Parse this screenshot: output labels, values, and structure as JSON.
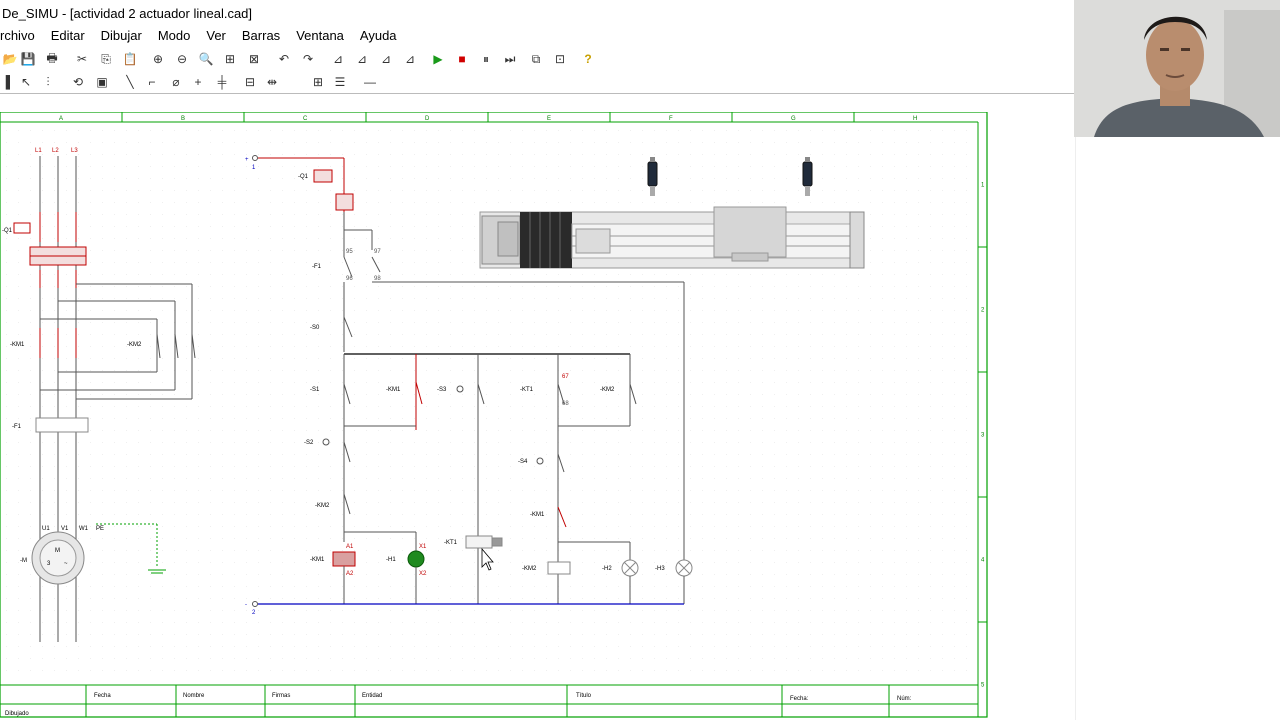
{
  "window": {
    "title": "De_SIMU - [actividad 2 actuador lineal.cad]"
  },
  "menu": [
    "rchivo",
    "Editar",
    "Dibujar",
    "Modo",
    "Ver",
    "Barras",
    "Ventana",
    "Ayuda"
  ],
  "toolbar1": [
    {
      "name": "open-icon",
      "glyph": "📂"
    },
    {
      "name": "save-icon",
      "glyph": "💾"
    },
    {
      "name": "print-icon",
      "glyph": "🖶"
    },
    {
      "name": "cut-icon",
      "glyph": "✂"
    },
    {
      "name": "copy-icon",
      "glyph": "⎘"
    },
    {
      "name": "paste-icon",
      "glyph": "📋"
    },
    {
      "name": "zoom-in-icon",
      "glyph": "⊕"
    },
    {
      "name": "zoom-out-icon",
      "glyph": "⊖"
    },
    {
      "name": "zoom-window-icon",
      "glyph": "🔍"
    },
    {
      "name": "zoom-all-icon",
      "glyph": "⊞"
    },
    {
      "name": "zoom-prev-icon",
      "glyph": "⊠"
    },
    {
      "name": "undo-icon",
      "glyph": "↶"
    },
    {
      "name": "redo-icon",
      "glyph": "↷"
    },
    {
      "name": "align-left-icon",
      "glyph": "⊿"
    },
    {
      "name": "align-right-icon",
      "glyph": "⊿"
    },
    {
      "name": "align-top-icon",
      "glyph": "⊿"
    },
    {
      "name": "align-bottom-icon",
      "glyph": "⊿"
    },
    {
      "name": "play-icon",
      "glyph": "▶"
    },
    {
      "name": "stop-icon",
      "glyph": "■"
    },
    {
      "name": "pause-icon",
      "glyph": "⏸"
    },
    {
      "name": "step-icon",
      "glyph": "⏭"
    },
    {
      "name": "window-icon",
      "glyph": "⧉"
    },
    {
      "name": "pin-icon",
      "glyph": "⊡"
    },
    {
      "name": "help-icon",
      "glyph": "?"
    }
  ],
  "toolbar2": [
    {
      "name": "line-thick-icon",
      "glyph": "▌"
    },
    {
      "name": "select-icon",
      "glyph": "↖"
    },
    {
      "name": "multi-select-icon",
      "glyph": "⫶"
    },
    {
      "name": "rotate-icon",
      "glyph": "⟲"
    },
    {
      "name": "component-icon",
      "glyph": "▣"
    },
    {
      "name": "contact-icon",
      "glyph": "╲"
    },
    {
      "name": "contact-alt-icon",
      "glyph": "⌐"
    },
    {
      "name": "node-icon",
      "glyph": "⌀"
    },
    {
      "name": "cross-icon",
      "glyph": "+"
    },
    {
      "name": "junction-icon",
      "glyph": "╪"
    },
    {
      "name": "terminal-icon",
      "glyph": "⊟"
    },
    {
      "name": "wire-icon",
      "glyph": "⇹"
    },
    {
      "name": "box-icon",
      "glyph": "⊞"
    },
    {
      "name": "list-icon",
      "glyph": "☰"
    },
    {
      "name": "line-icon",
      "glyph": "—"
    }
  ],
  "colors": {
    "frame": "#00a000",
    "accent_red": "#c00000",
    "wire_blue": "#0000c0"
  },
  "sheet": {
    "columns": [
      "A",
      "B",
      "C",
      "D",
      "E",
      "F",
      "G",
      "H"
    ],
    "rows": [
      "1",
      "2",
      "3",
      "4",
      "5"
    ],
    "titleblock": {
      "dibujado": "Dibujado",
      "fecha": "Fecha",
      "nombre": "Nombre",
      "firmas": "Firmas",
      "entidad": "Entidad",
      "titulo": "Título",
      "fecha2": "Fecha:",
      "num": "Núm:"
    }
  },
  "power_circuit": {
    "lines": [
      "L1",
      "L2",
      "L3"
    ],
    "q1_label": "-Q1",
    "km1_label": "-KM1",
    "km2_label": "-KM2",
    "f1_label": "-F1",
    "motor_label": "-M",
    "motor_terminals": [
      "U1",
      "V1",
      "W1"
    ],
    "pe": "PE",
    "motor_text": [
      "M",
      "3",
      "~"
    ],
    "pins": [
      "1",
      "3",
      "5",
      "2",
      "4",
      "6"
    ]
  },
  "control_circuit": {
    "supply_top": "+",
    "supply_bottom": "-",
    "supply_labels": [
      "1",
      "2"
    ],
    "q1": "-Q1",
    "f1": "-F1",
    "s0": "-S0",
    "s1": "-S1",
    "s2": "-S2",
    "s3": "-S3",
    "s4": "-S4",
    "km1": "-KM1",
    "km2": "-KM2",
    "kt1": "-KT1",
    "h1": "-H1",
    "h2": "-H2",
    "h3": "-H3",
    "contacts": [
      "95",
      "96",
      "97",
      "98",
      "11",
      "12",
      "13",
      "14",
      "67",
      "68",
      "A1",
      "A2",
      "X1",
      "X2"
    ]
  }
}
